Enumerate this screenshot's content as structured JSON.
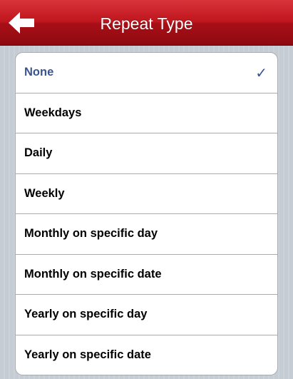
{
  "navbar": {
    "title": "Repeat Type",
    "back_icon": "left-arrow-icon"
  },
  "repeat_options": {
    "selected_index": 0,
    "check_icon": "checkmark-icon",
    "check_glyph": "✓",
    "items": [
      {
        "label": "None"
      },
      {
        "label": "Weekdays"
      },
      {
        "label": "Daily"
      },
      {
        "label": "Weekly"
      },
      {
        "label": "Monthly on specific day"
      },
      {
        "label": "Monthly on specific date"
      },
      {
        "label": "Yearly on specific day"
      },
      {
        "label": "Yearly on specific date"
      }
    ]
  },
  "colors": {
    "navbar_red": "#c0161e",
    "selected_blue": "#3a5490",
    "background": "#c5ccd4"
  }
}
